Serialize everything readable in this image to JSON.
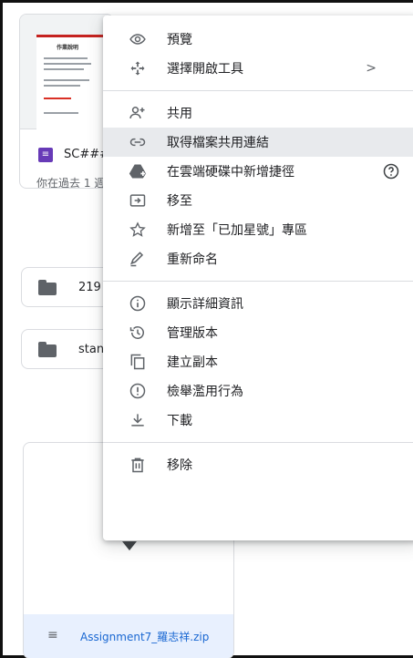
{
  "background": {
    "file_card": {
      "doc_badge_glyph": "≡",
      "name": "SC####",
      "subtitle": "你在過去 1 週",
      "thumb_title": "作業說明"
    },
    "folders": [
      {
        "name": "219"
      },
      {
        "name": "stan"
      }
    ],
    "zip_card": {
      "name": "Assignment7_羅志祥.zip",
      "icon_glyph": "≡"
    }
  },
  "menu": {
    "groups": [
      [
        {
          "label": "預覽",
          "icon": "eye-icon"
        },
        {
          "label": "選擇開啟工具",
          "icon": "open-with-icon",
          "trailing": ">"
        }
      ],
      [
        {
          "label": "共用",
          "icon": "person-add-icon"
        },
        {
          "label": "取得檔案共用連結",
          "icon": "link-icon",
          "active": true
        },
        {
          "label": "在雲端硬碟中新增捷徑",
          "icon": "drive-add-shortcut-icon",
          "help": true
        },
        {
          "label": "移至",
          "icon": "move-to-icon"
        },
        {
          "label": "新增至「已加星號」專區",
          "icon": "star-icon"
        },
        {
          "label": "重新命名",
          "icon": "pencil-icon"
        }
      ],
      [
        {
          "label": "顯示詳細資訊",
          "icon": "info-icon"
        },
        {
          "label": "管理版本",
          "icon": "history-icon"
        },
        {
          "label": "建立副本",
          "icon": "copy-icon"
        },
        {
          "label": "檢舉濫用行為",
          "icon": "report-icon"
        },
        {
          "label": "下載",
          "icon": "download-icon"
        }
      ],
      [
        {
          "label": "移除",
          "icon": "trash-icon"
        }
      ]
    ]
  },
  "colors": {
    "menu_active_bg": "#e8eaed",
    "icon_gray": "#5f6368",
    "doc_purple": "#673ab7",
    "link_blue": "#1967d2"
  }
}
